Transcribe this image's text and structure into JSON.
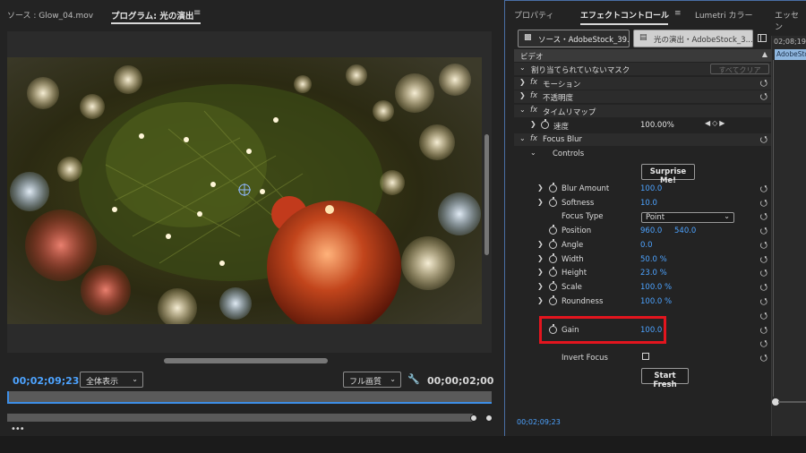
{
  "program": {
    "source_tab": "ソース : Glow_04.mov",
    "program_tab": "プログラム: 光の演出",
    "tab_menu": "≡",
    "timecode_current": "00;02;09;23",
    "fit_dropdown": "全体表示",
    "resolution_dropdown": "フル画質",
    "timecode_duration": "00;00;02;00",
    "dots": "•••"
  },
  "effect_controls": {
    "tabs": [
      "プロパティ",
      "エフェクトコントロール",
      "Lumetri カラー",
      "エッセン"
    ],
    "tab_menu": "≡",
    "source_button": "ソース・AdobeStock_39...",
    "sequence_button": "光の演出・AdobeStock_3...",
    "timeline_timecode": "02;08;19",
    "timeline_clip": "AdobeSto",
    "video_header": "ビデオ",
    "clear_all": "すべてクリア",
    "unassigned_mask": "割り当てられていないマスク",
    "motion": "モーション",
    "opacity": "不透明度",
    "time_remap": "タイムリマップ",
    "speed_label": "速度",
    "speed_value": "100.00%",
    "effect_name": "Focus Blur",
    "controls": "Controls",
    "surprise_button": "Surprise Me!",
    "params": {
      "blur_amount": {
        "label": "Blur Amount",
        "value": "100.0"
      },
      "softness": {
        "label": "Softness",
        "value": "10.0"
      },
      "focus_type": {
        "label": "Focus Type",
        "value": "Point"
      },
      "position": {
        "label": "Position",
        "x": "960.0",
        "y": "540.0"
      },
      "angle": {
        "label": "Angle",
        "value": "0.0"
      },
      "width": {
        "label": "Width",
        "value": "50.0 %"
      },
      "height": {
        "label": "Height",
        "value": "23.0 %"
      },
      "scale": {
        "label": "Scale",
        "value": "100.0 %"
      },
      "roundness": {
        "label": "Roundness",
        "value": "100.0 %"
      },
      "gain": {
        "label": "Gain",
        "value": "100.0"
      },
      "invert_focus": {
        "label": "Invert Focus"
      }
    },
    "start_fresh": "Start Fresh",
    "timecode": "00;02;09;23"
  },
  "colors": {
    "accent_blue": "#4da3ff",
    "highlight_red": "#e3151e"
  }
}
